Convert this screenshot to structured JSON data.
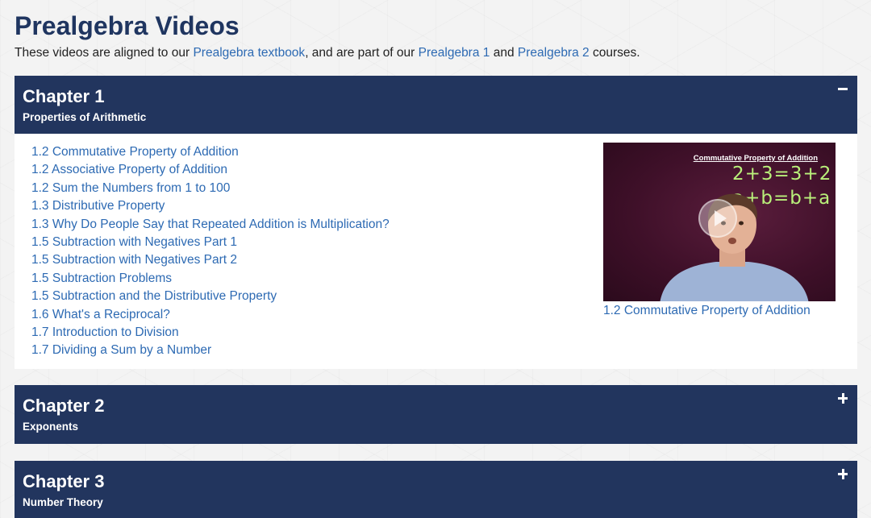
{
  "page": {
    "title": "Prealgebra Videos",
    "intro": {
      "text_1": "These videos are aligned to our ",
      "link_textbook": "Prealgebra textbook",
      "text_2": ", and are part of our ",
      "link_course_1": "Prealgebra 1",
      "text_3": " and ",
      "link_course_2": "Prealgebra 2",
      "text_4": " courses."
    }
  },
  "chapters": [
    {
      "title": "Chapter 1",
      "subtitle": "Properties of Arithmetic",
      "toggle": "collapse",
      "videos": [
        "1.2 Commutative Property of Addition",
        "1.2 Associative Property of Addition",
        "1.2 Sum the Numbers from 1 to 100",
        "1.3 Distributive Property",
        "1.3 Why Do People Say that Repeated Addition is Multiplication?",
        "1.5 Subtraction with Negatives Part 1",
        "1.5 Subtraction with Negatives Part 2",
        "1.5 Subtraction Problems",
        "1.5 Subtraction and the Distributive Property",
        "1.6 What's a Reciprocal?",
        "1.7 Introduction to Division",
        "1.7 Dividing a Sum by a Number"
      ],
      "featured": {
        "board_title": "Commutative Property of Addition",
        "equation_1": "2+3=3+2",
        "equation_2": "a+b=b+a",
        "caption": "1.2 Commutative Property of Addition"
      }
    },
    {
      "title": "Chapter 2",
      "subtitle": "Exponents",
      "toggle": "expand"
    },
    {
      "title": "Chapter 3",
      "subtitle": "Number Theory",
      "toggle": "expand"
    }
  ],
  "colors": {
    "header_bg": "#22355e",
    "title": "#1f3560",
    "link": "#2d6ab3"
  },
  "icons": {
    "collapse": "minus-icon",
    "expand": "plus-icon",
    "play": "play-icon"
  }
}
